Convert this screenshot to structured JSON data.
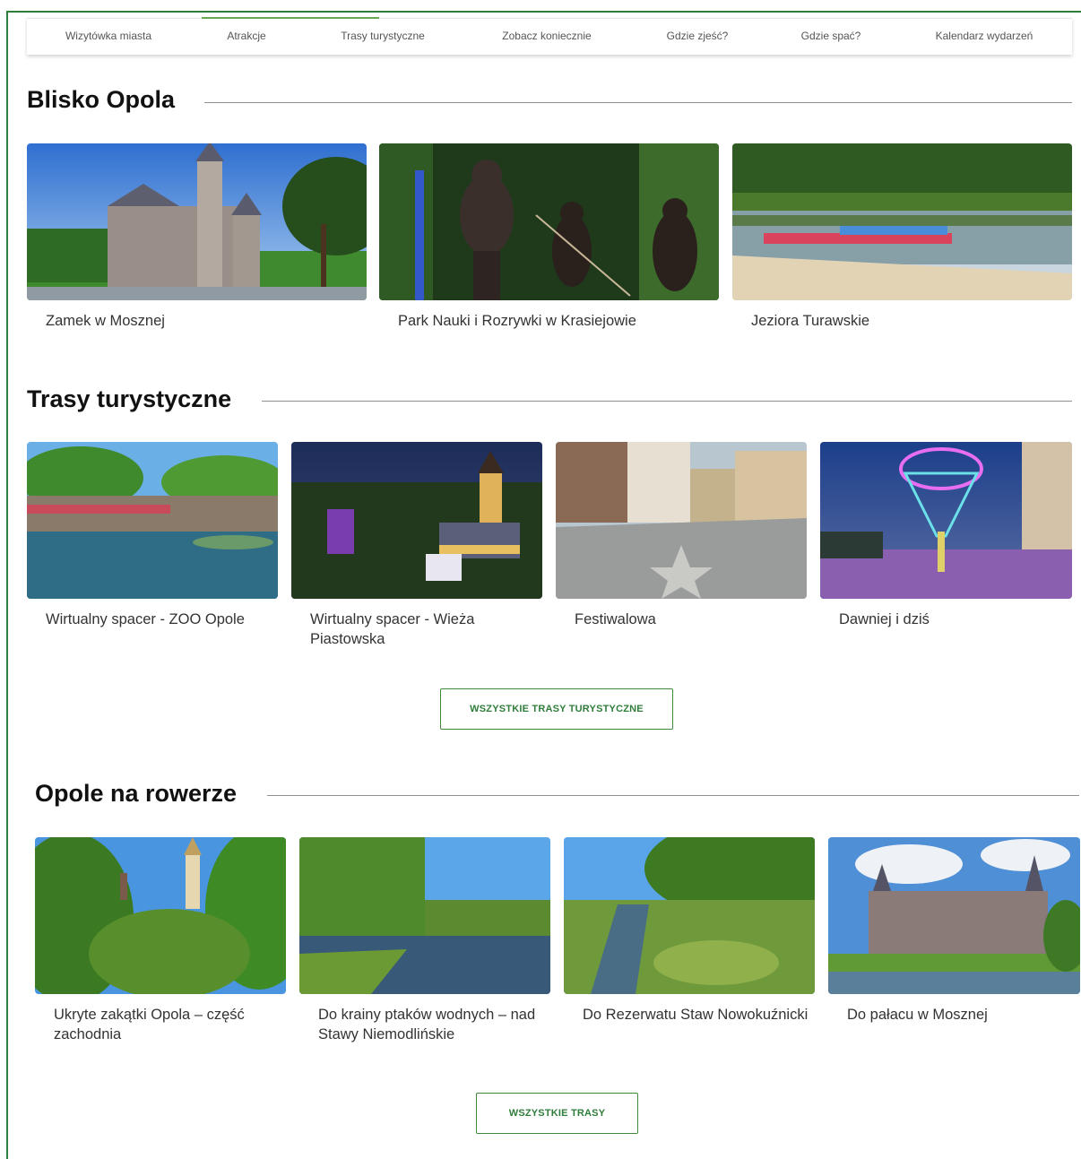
{
  "nav": {
    "items": [
      "Wizytówka miasta",
      "Atrakcje",
      "Trasy turystyczne",
      "Zobacz koniecznie",
      "Gdzie zjeść?",
      "Gdzie spać?",
      "Kalendarz wydarzeń"
    ]
  },
  "sections": {
    "blisko": {
      "title": "Blisko Opola",
      "cards": [
        {
          "caption": "Zamek w Mosznej"
        },
        {
          "caption": "Park Nauki i Rozrywki w Krasiejowie"
        },
        {
          "caption": "Jeziora Turawskie"
        }
      ]
    },
    "trasy": {
      "title": "Trasy turystyczne",
      "cards": [
        {
          "caption": "Wirtualny spacer - ZOO Opole"
        },
        {
          "caption": "Wirtualny spacer - Wieża Piastowska"
        },
        {
          "caption": "Festiwalowa"
        },
        {
          "caption": "Dawniej i dziś"
        }
      ],
      "button": "WSZYSTKIE TRASY TURYSTYCZNE"
    },
    "rower": {
      "title": "Opole na rowerze",
      "cards": [
        {
          "caption": "Ukryte zakątki Opola – część zachodnia"
        },
        {
          "caption": "Do krainy ptaków wodnych – nad Stawy Niemodlińskie"
        },
        {
          "caption": "Do Rezerwatu Staw Nowokuźnicki"
        },
        {
          "caption": "Do pałacu w Mosznej"
        }
      ],
      "button": "WSZYSTKIE TRASY"
    }
  },
  "colors": {
    "accent": "#2f7d3a",
    "accent_light": "#6aa84f"
  }
}
